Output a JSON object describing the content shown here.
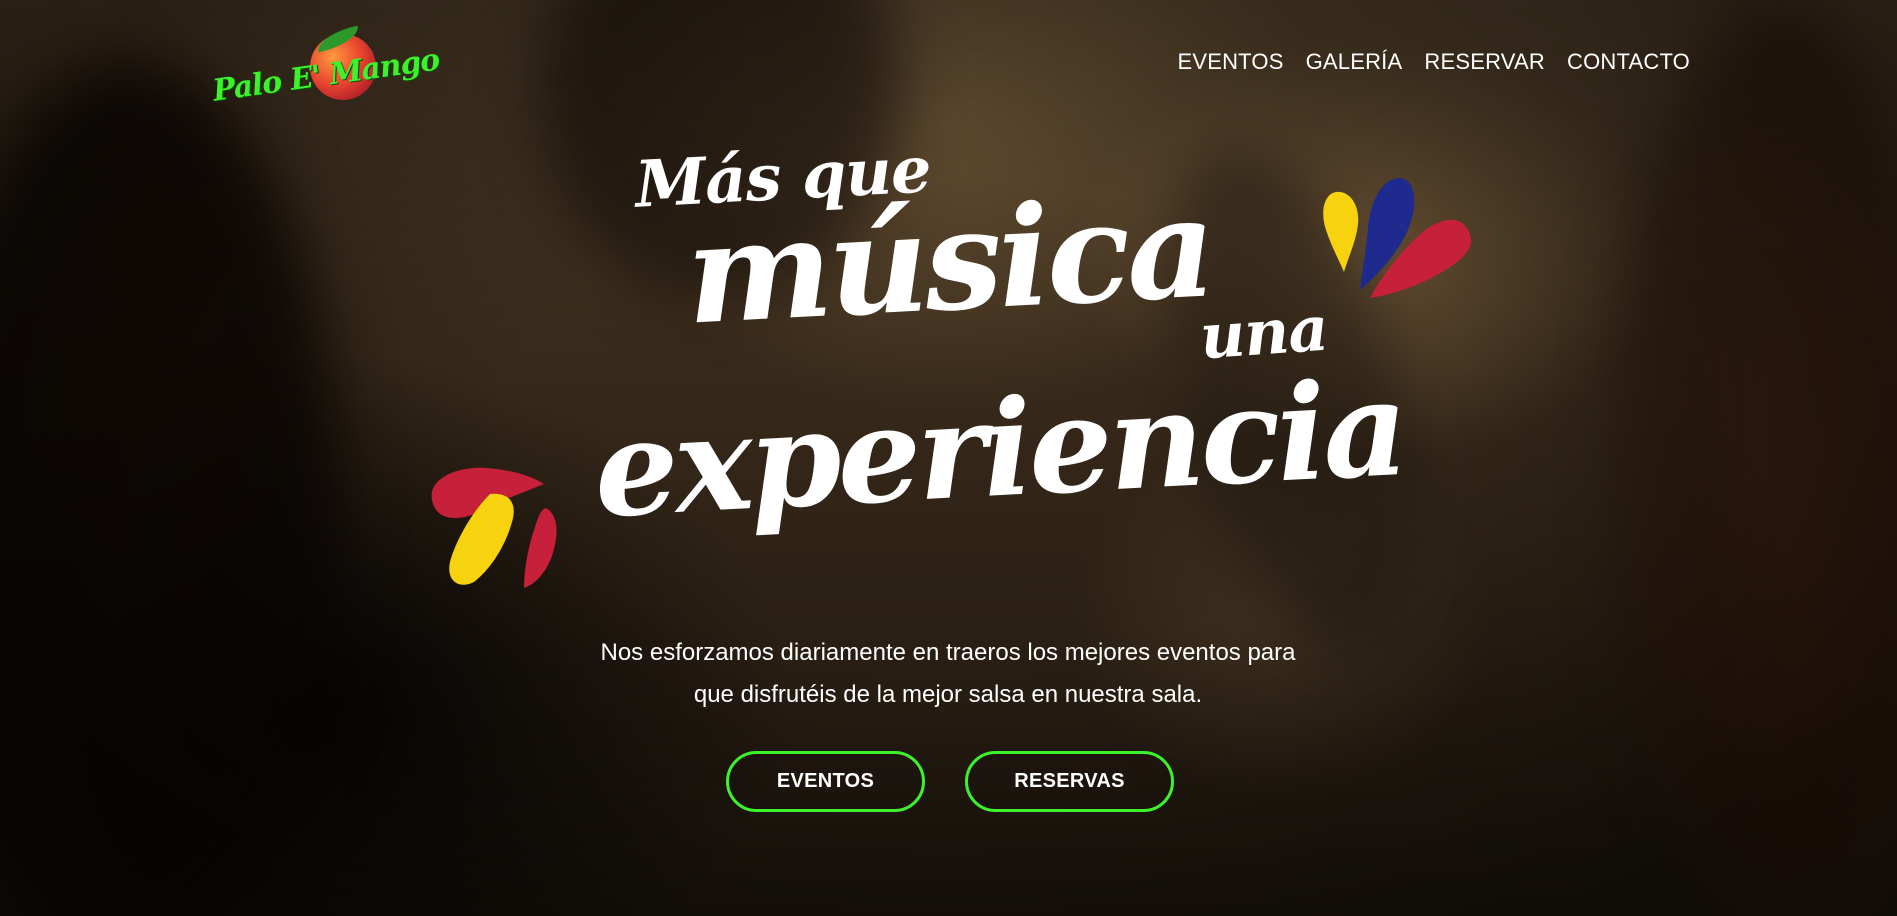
{
  "brand": {
    "logo_text": "Palo E' Mango",
    "logo_color": "#3df22a"
  },
  "nav": {
    "items": [
      {
        "label": "EVENTOS"
      },
      {
        "label": "GALERÍA"
      },
      {
        "label": "RESERVAR"
      },
      {
        "label": "CONTACTO"
      }
    ]
  },
  "hero": {
    "line1": "Más que",
    "line2": "música",
    "line3": "una",
    "line4": "experiencia",
    "description_line1": "Nos esforzamos diariamente en traeros los mejores eventos para",
    "description_line2": "que disfrutéis de la mejor salsa en nuestra sala.",
    "decor_colors": {
      "yellow": "#f6d20f",
      "blue": "#1f2a8f",
      "red": "#c6203a"
    }
  },
  "buttons": {
    "eventos_label": "EVENTOS",
    "reservas_label": "RESERVAS",
    "border_color": "#3df22a"
  }
}
